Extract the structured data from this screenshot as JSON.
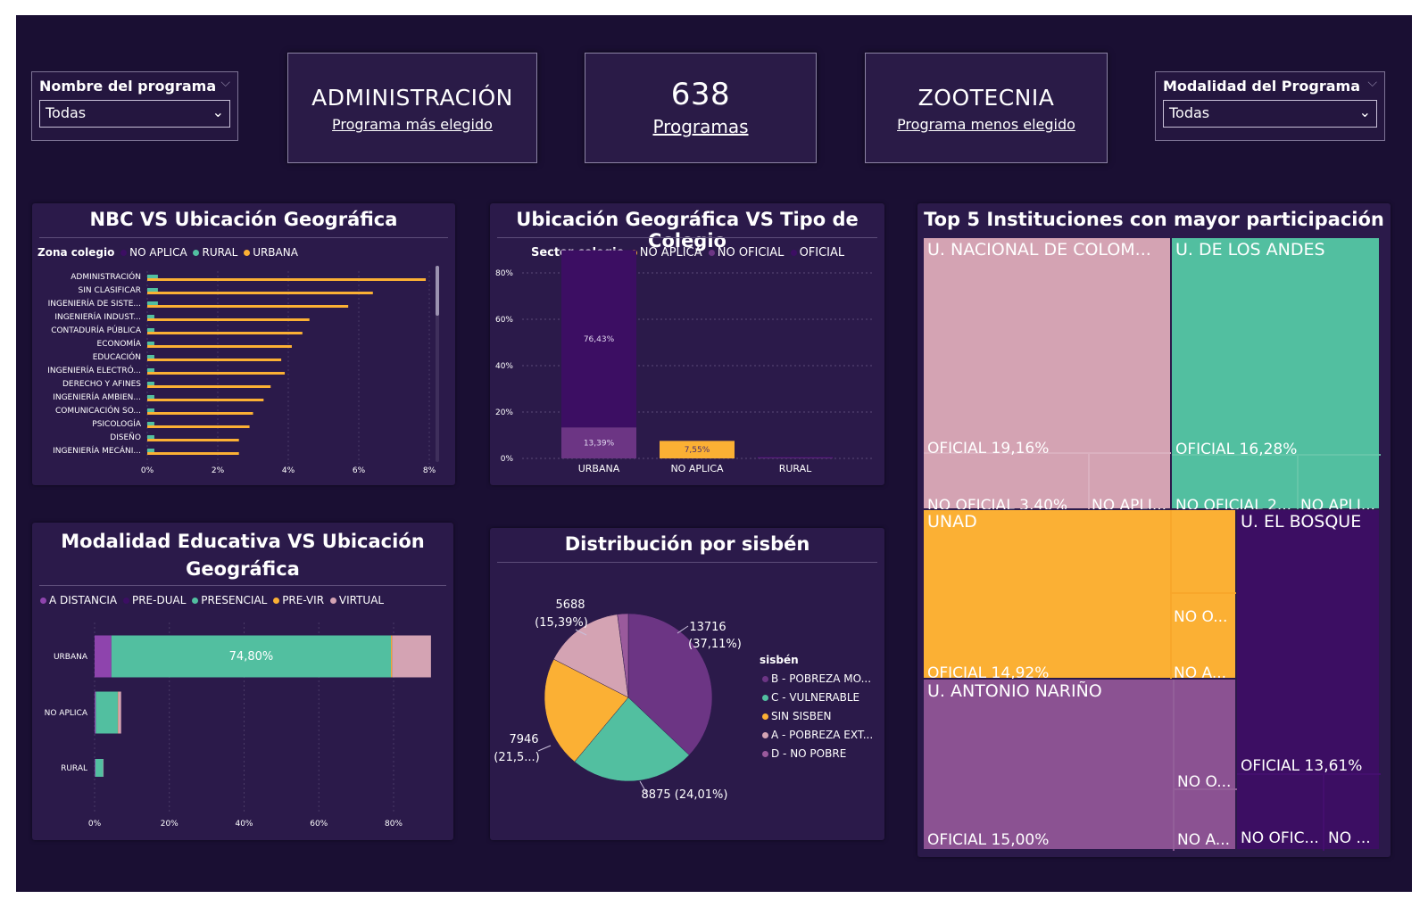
{
  "colors": {
    "background": "#1a0f33",
    "panel": "#2b1a4a",
    "yellow": "#fbb034",
    "teal": "#52bfa0",
    "pink": "#d4a3b3",
    "purple": "#6c3584",
    "dark_purple": "#3c0e63",
    "mauve": "#8b5292"
  },
  "slicer_left": {
    "title": "Nombre del programa",
    "value": "Todas"
  },
  "slicer_right": {
    "title": "Modalidad del Programa",
    "value": "Todas"
  },
  "card_most": {
    "value": "ADMINISTRACIÓN",
    "label": "Programa más elegido"
  },
  "card_count": {
    "value": "638",
    "label": "Programas"
  },
  "card_least": {
    "value": "ZOOTECNIA",
    "label": "Programa menos elegido"
  },
  "nbc": {
    "title": "NBC VS Ubicación Geográfica",
    "legend_title": "Zona colegio",
    "legend": [
      "NO APLICA",
      "RURAL",
      "URBANA"
    ]
  },
  "tipo": {
    "title": "Ubicación Geográfica VS Tipo de Colegio",
    "legend_title": "Sector colegio",
    "legend": [
      "NO APLICA",
      "NO OFICIAL",
      "OFICIAL"
    ]
  },
  "top5": {
    "title": "Top 5 Instituciones con mayor participación"
  },
  "modalidad": {
    "title_line1": "Modalidad Educativa VS Ubicación",
    "title_line2": "Geográfica",
    "legend": [
      "A DISTANCIA",
      "PRE-DUAL",
      "PRESENCIAL",
      "PRE-VIR",
      "VIRTUAL"
    ]
  },
  "sisben": {
    "title": "Distribución por sisbén",
    "legend_title": "sisbén",
    "legend": [
      "B - POBREZA MO...",
      "C - VULNERABLE",
      "SIN SISBEN",
      "A - POBREZA EXT...",
      "D - NO POBRE"
    ]
  },
  "chart_data": [
    {
      "type": "bar",
      "orientation": "horizontal",
      "title": "NBC VS Ubicación Geográfica",
      "categories": [
        "ADMINISTRACIÓN",
        "SIN CLASIFICAR",
        "INGENIERÍA DE SISTE...",
        "INGENIERÍA INDUST...",
        "CONTADURÍA PÚBLICA",
        "ECONOMÍA",
        "EDUCACIÓN",
        "INGENIERÍA ELECTRÓ...",
        "DERECHO Y AFINES",
        "INGENIERÍA AMBIEN...",
        "COMUNICACIÓN SO...",
        "PSICOLOGÍA",
        "DISEÑO",
        "INGENIERÍA MECÁNI..."
      ],
      "series": [
        {
          "name": "URBANA",
          "color": "#fbb034",
          "values": [
            7.9,
            6.4,
            5.7,
            4.6,
            4.4,
            4.1,
            3.8,
            3.9,
            3.5,
            3.3,
            3.0,
            2.9,
            2.6,
            2.6
          ]
        },
        {
          "name": "RURAL",
          "color": "#52bfa0",
          "values": [
            0.2,
            0.2,
            0.2,
            0.1,
            0.1,
            0.1,
            0.1,
            0.1,
            0.1,
            0.1,
            0.1,
            0.1,
            0.1,
            0.1
          ]
        }
      ],
      "xticks": [
        "0%",
        "2%",
        "4%",
        "6%",
        "8%"
      ],
      "xlim": [
        0,
        8
      ]
    },
    {
      "type": "bar",
      "stacked": true,
      "title": "Ubicación Geográfica VS Tipo de Colegio",
      "categories": [
        "URBANA",
        "NO APLICA",
        "RURAL"
      ],
      "series": [
        {
          "name": "OFICIAL",
          "color": "#3c0e63",
          "values": [
            76.43,
            0,
            0.4
          ]
        },
        {
          "name": "NO OFICIAL",
          "color": "#6c3584",
          "values": [
            13.39,
            0,
            0.3
          ]
        },
        {
          "name": "NO APLICA",
          "color": "#fbb034",
          "values": [
            0,
            7.55,
            0
          ]
        }
      ],
      "data_labels": [
        "76,43%",
        "13,39%",
        "7,55%"
      ],
      "yticks": [
        "0%",
        "20%",
        "40%",
        "60%",
        "80%"
      ],
      "ylim": [
        0,
        90
      ]
    },
    {
      "type": "treemap",
      "title": "Top 5 Instituciones con mayor participación",
      "items": [
        {
          "name": "U. NACIONAL DE COLOM...",
          "color": "#d4a3b3",
          "leaves": [
            {
              "label": "OFICIAL 19,16%"
            },
            {
              "label": "NO OFICIAL 3,40%"
            },
            {
              "label": "NO APLI..."
            }
          ]
        },
        {
          "name": "U. DE LOS ANDES",
          "color": "#52bfa0",
          "leaves": [
            {
              "label": "OFICIAL 16,28%"
            },
            {
              "label": "NO OFICIAL 2..."
            },
            {
              "label": "NO APLI..."
            }
          ]
        },
        {
          "name": "UNAD",
          "color": "#fbb034",
          "leaves": [
            {
              "label": "OFICIAL 14,92%"
            },
            {
              "label": "NO O..."
            },
            {
              "label": "NO A..."
            }
          ]
        },
        {
          "name": "U. EL BOSQUE",
          "color": "#3c0e63",
          "leaves": [
            {
              "label": "OFICIAL 13,61%"
            },
            {
              "label": "NO OFIC..."
            },
            {
              "label": "NO ..."
            }
          ]
        },
        {
          "name": "U. ANTONIO NARIÑO",
          "color": "#8b5292",
          "leaves": [
            {
              "label": "OFICIAL 15,00%"
            },
            {
              "label": "NO O..."
            },
            {
              "label": "NO A..."
            }
          ]
        }
      ]
    },
    {
      "type": "bar",
      "orientation": "horizontal",
      "stacked": true,
      "title": "Modalidad Educativa VS Ubicación Geográfica",
      "categories": [
        "URBANA",
        "NO APLICA",
        "RURAL"
      ],
      "series": [
        {
          "name": "A DISTANCIA",
          "color": "#8e44ad",
          "values": [
            4.5,
            0.3,
            0.2
          ]
        },
        {
          "name": "PRESENCIAL",
          "color": "#52bfa0",
          "values": [
            74.8,
            5.9,
            2.1
          ]
        },
        {
          "name": "PRE-VIR",
          "color": "#fbb034",
          "values": [
            0.3,
            0.1,
            0.0
          ]
        },
        {
          "name": "VIRTUAL",
          "color": "#d4a3b3",
          "values": [
            10.4,
            0.8,
            0.1
          ]
        }
      ],
      "data_labels": [
        "74,80%"
      ],
      "xticks": [
        "0%",
        "20%",
        "40%",
        "60%",
        "80%"
      ],
      "xlim": [
        0,
        90
      ]
    },
    {
      "type": "pie",
      "title": "Distribución por sisbén",
      "slices": [
        {
          "name": "B - POBREZA MO...",
          "value": 13716,
          "label": "13716",
          "pct": "(37,11%)",
          "color": "#6c3584"
        },
        {
          "name": "C - VULNERABLE",
          "value": 8875,
          "label": "8875 (24,01%)",
          "color": "#52bfa0"
        },
        {
          "name": "SIN SISBEN",
          "value": 7946,
          "label": "7946",
          "pct": "(21,5...)",
          "color": "#fbb034"
        },
        {
          "name": "A - POBREZA EXT...",
          "value": 5688,
          "label": "5688",
          "pct": "(15,39%)",
          "color": "#d4a3b3"
        },
        {
          "name": "D - NO POBRE",
          "value": 770,
          "color": "#9a5a9c"
        }
      ]
    }
  ]
}
